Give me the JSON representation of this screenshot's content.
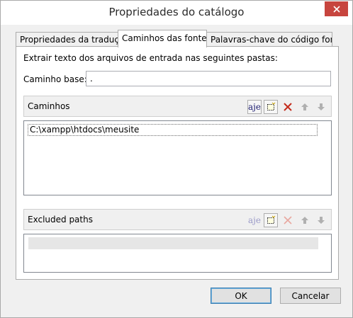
{
  "window": {
    "title": "Propriedades do catálogo"
  },
  "tabs": [
    {
      "label": "Propriedades da tradução",
      "active": false
    },
    {
      "label": "Caminhos das fontes",
      "active": true
    },
    {
      "label": "Palavras-chave do código fonte",
      "active": false
    }
  ],
  "panel": {
    "intro": "Extrair texto dos arquivos de entrada nas seguintes pastas:",
    "base_path_label": "Caminho base:",
    "base_path_value": "."
  },
  "paths": {
    "title": "Caminhos",
    "items": [
      "C:\\xampp\\htdocs\\meusite"
    ],
    "toolbar": {
      "rename_glyph": "aje",
      "icons": [
        "rename-icon",
        "add-folder-icon",
        "delete-icon",
        "move-up-icon",
        "move-down-icon"
      ]
    }
  },
  "excluded": {
    "title": "Excluded paths",
    "items": [],
    "toolbar": {
      "rename_glyph": "aje",
      "icons": [
        "rename-icon",
        "add-folder-icon",
        "delete-icon",
        "move-up-icon",
        "move-down-icon"
      ]
    }
  },
  "buttons": {
    "ok": "OK",
    "cancel": "Cancelar"
  },
  "colors": {
    "close_button": "#c7453e",
    "delete_icon_enabled": "#c42b1c",
    "disabled_icon": "#b0b0b0"
  }
}
